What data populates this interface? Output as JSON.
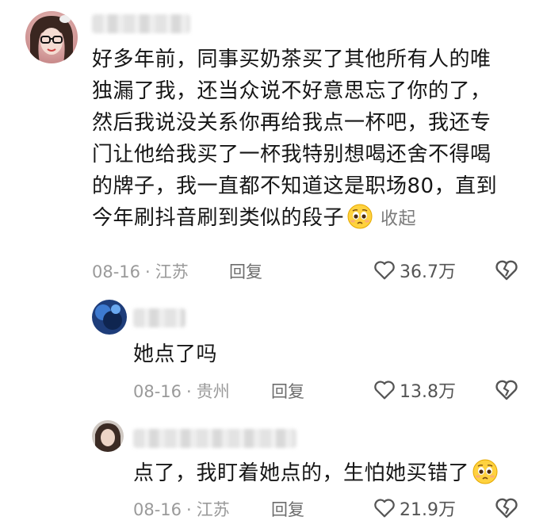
{
  "comments": [
    {
      "lines": [
        "好多年前，同事买奶茶买了其他所有人的唯",
        "独漏了我，还当众说不好意思忘了你的了，",
        "然后我说没关系你再给我点一杯吧，我还专",
        "门让他给我买了一杯我特别想喝还舍不得喝",
        "的牌子，我一直都不知道这是职场80，直到",
        "今年刷抖音刷到类似的段子"
      ],
      "collapse_label": "收起",
      "emoji": "pleading-face-emoji",
      "date": "08-16",
      "location": "江苏",
      "reply_label": "回复",
      "likes": "36.7万"
    },
    {
      "lines": [
        "她点了吗"
      ],
      "date": "08-16",
      "location": "贵州",
      "reply_label": "回复",
      "likes": "13.8万"
    },
    {
      "lines": [
        "点了，我盯着她点的，生怕她买错了"
      ],
      "emoji": "pleading-face-emoji",
      "date": "08-16",
      "location": "江苏",
      "reply_label": "回复",
      "likes": "21.9万"
    }
  ],
  "separator": "·",
  "colors": {
    "text": "#161616",
    "meta": "#9a9a9a",
    "reply": "#6d6d6d",
    "icon": "#555555"
  }
}
